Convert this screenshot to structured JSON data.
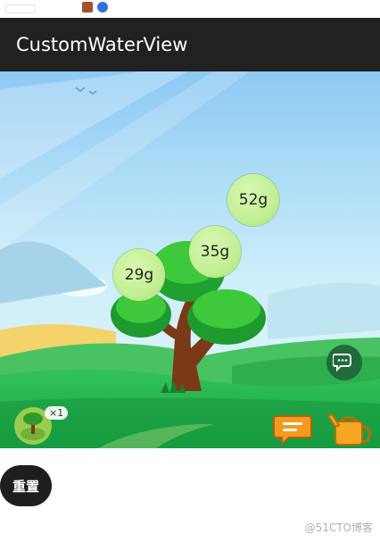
{
  "app": {
    "title": "CustomWaterView"
  },
  "bubbles": [
    {
      "label": "52g"
    },
    {
      "label": "35g"
    },
    {
      "label": "29g"
    }
  ],
  "tree": {
    "count_label": "×1"
  },
  "actions": {
    "reset_label": "重置"
  },
  "watermark": "@51CTO博客",
  "icons": {
    "chat": "chat-bubbles-icon",
    "message": "message-icon",
    "watering_can": "watering-can-icon",
    "avatar": "tree-avatar-icon"
  },
  "colors": {
    "appbar": "#212121",
    "bubble": "#c2ef96",
    "reset_button": "#1e1e1e",
    "grass": "#1fa84a",
    "trunk": "#7a3a16"
  }
}
